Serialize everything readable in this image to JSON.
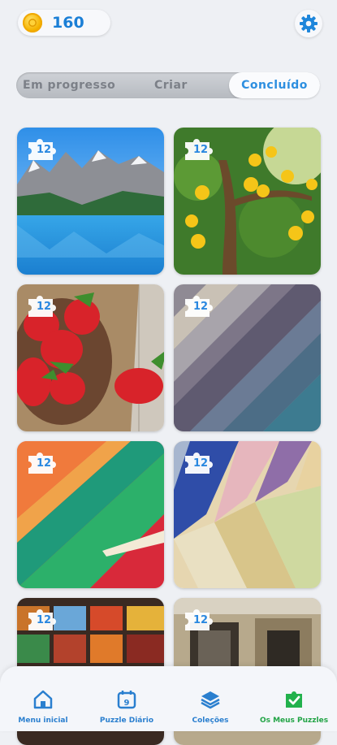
{
  "header": {
    "coins": "160",
    "coin_icon": "coin-icon",
    "settings_icon": "gear-icon"
  },
  "tabs": [
    {
      "label": "Em progresso",
      "active": false
    },
    {
      "label": "Criar",
      "active": false
    },
    {
      "label": "Concluído",
      "active": true
    }
  ],
  "puzzles": [
    {
      "image": "mountain-lake",
      "pieces": "12"
    },
    {
      "image": "lemon-tree",
      "pieces": "12"
    },
    {
      "image": "strawberries",
      "pieces": "12"
    },
    {
      "image": "fabric-swatches-gray",
      "pieces": "12"
    },
    {
      "image": "color-swatches",
      "pieces": "12"
    },
    {
      "image": "fabric-swatches-colored",
      "pieces": "12"
    },
    {
      "image": "spice-bowls",
      "pieces": "12"
    },
    {
      "image": "old-building",
      "pieces": "12"
    }
  ],
  "nav": [
    {
      "label": "Menu inicial",
      "icon": "home-icon"
    },
    {
      "label": "Puzzle Diário",
      "icon": "calendar-icon",
      "badge": "9"
    },
    {
      "label": "Coleções",
      "icon": "layers-icon"
    },
    {
      "label": "Os Meus Puzzles",
      "icon": "puzzle-check-icon",
      "active": true
    }
  ],
  "colors": {
    "accent": "#2a88e0",
    "active_nav": "#22b14c"
  }
}
